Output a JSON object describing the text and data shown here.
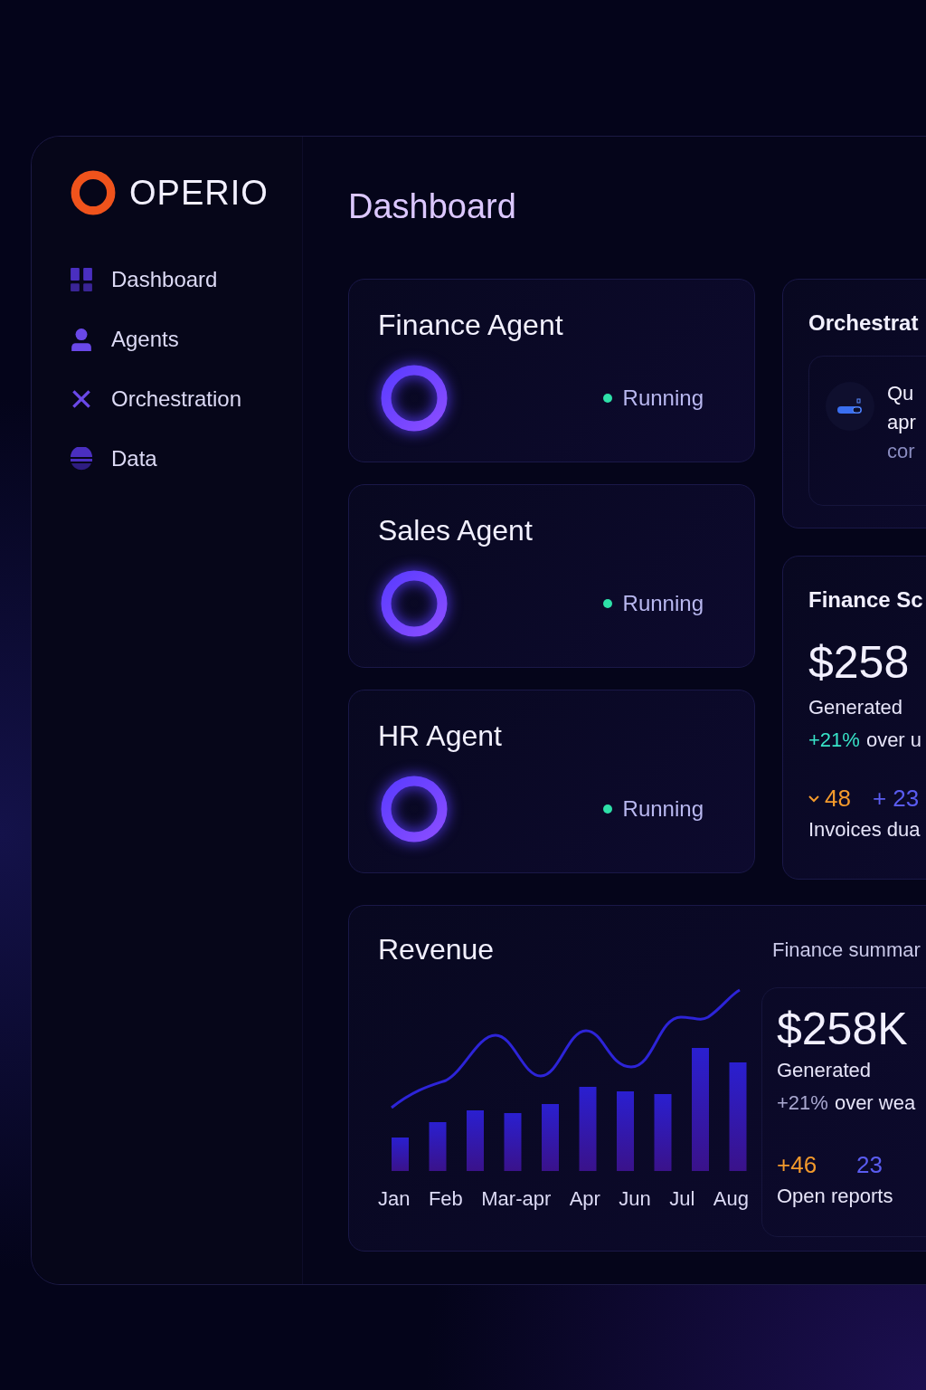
{
  "brand": "OPERIO",
  "nav": [
    {
      "label": "Dashboard"
    },
    {
      "label": "Agents"
    },
    {
      "label": "Orchestration"
    },
    {
      "label": "Data"
    }
  ],
  "page_title": "Dashboard",
  "agents": [
    {
      "name": "Finance Agent",
      "status": "Running"
    },
    {
      "name": "Sales Agent",
      "status": "Running"
    },
    {
      "name": "HR Agent",
      "status": "Running"
    }
  ],
  "orchestration": {
    "title": "Orchestrat",
    "task_lines": [
      "Qu",
      "apr"
    ],
    "task_note": "cor"
  },
  "finance_score": {
    "title": "Finance Sc",
    "amount": "$258",
    "caption": "Generated",
    "change": "+21%",
    "change_text": "over u",
    "stat_down": "48",
    "stat_up": "+ 23",
    "stat_caption": "Invoices dua"
  },
  "revenue": {
    "title": "Revenue",
    "months": [
      "Jan",
      "Feb",
      "Mar-apr",
      "Apr",
      "Jun",
      "Jul",
      "Aug"
    ],
    "summary_label": "Finance summar",
    "amount": "$258K",
    "caption": "Generated",
    "change": "+21%",
    "change_text": "over wea",
    "stat_a": "+46",
    "stat_b": "23",
    "stat_caption": "Open reports"
  }
}
